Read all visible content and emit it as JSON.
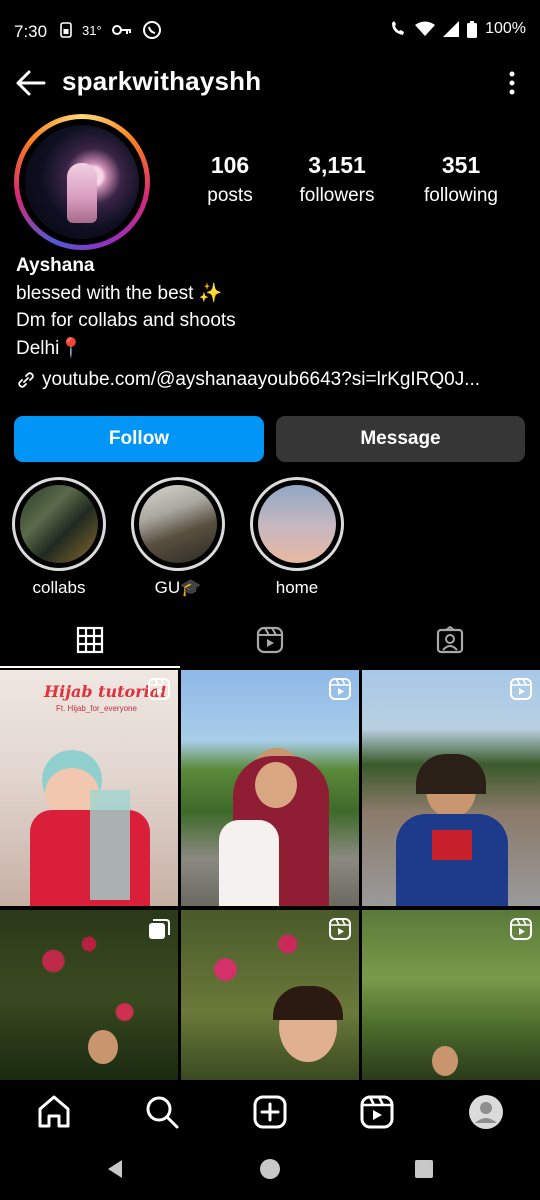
{
  "status_bar": {
    "time": "7:30",
    "temperature": "31°",
    "battery": "100%"
  },
  "header": {
    "username": "sparkwithayshh"
  },
  "stats": [
    {
      "value": "106",
      "label": "posts"
    },
    {
      "value": "3,151",
      "label": "followers"
    },
    {
      "value": "351",
      "label": "following"
    }
  ],
  "bio": {
    "name": "Ayshana",
    "line1": "blessed with the best ✨",
    "line2": "Dm for collabs and shoots",
    "line3": "Delhi📍",
    "link": "youtube.com/@ayshanaayoub6643?si=lrKgIRQ0J..."
  },
  "buttons": {
    "follow": "Follow",
    "message": "Message"
  },
  "highlights": [
    {
      "label": "collabs"
    },
    {
      "label": "GU🎓"
    },
    {
      "label": "home"
    }
  ],
  "grid_posts": [
    {
      "caption": "Hijab tutorial",
      "sub": "Ft. Hijab_for_everyone",
      "type": "reel"
    },
    {
      "type": "reel"
    },
    {
      "type": "reel"
    },
    {
      "type": "carousel"
    },
    {
      "type": "reel"
    },
    {
      "type": "reel"
    }
  ],
  "colors": {
    "follow_button": "#0095f6",
    "message_button": "#363636",
    "background": "#000000"
  }
}
